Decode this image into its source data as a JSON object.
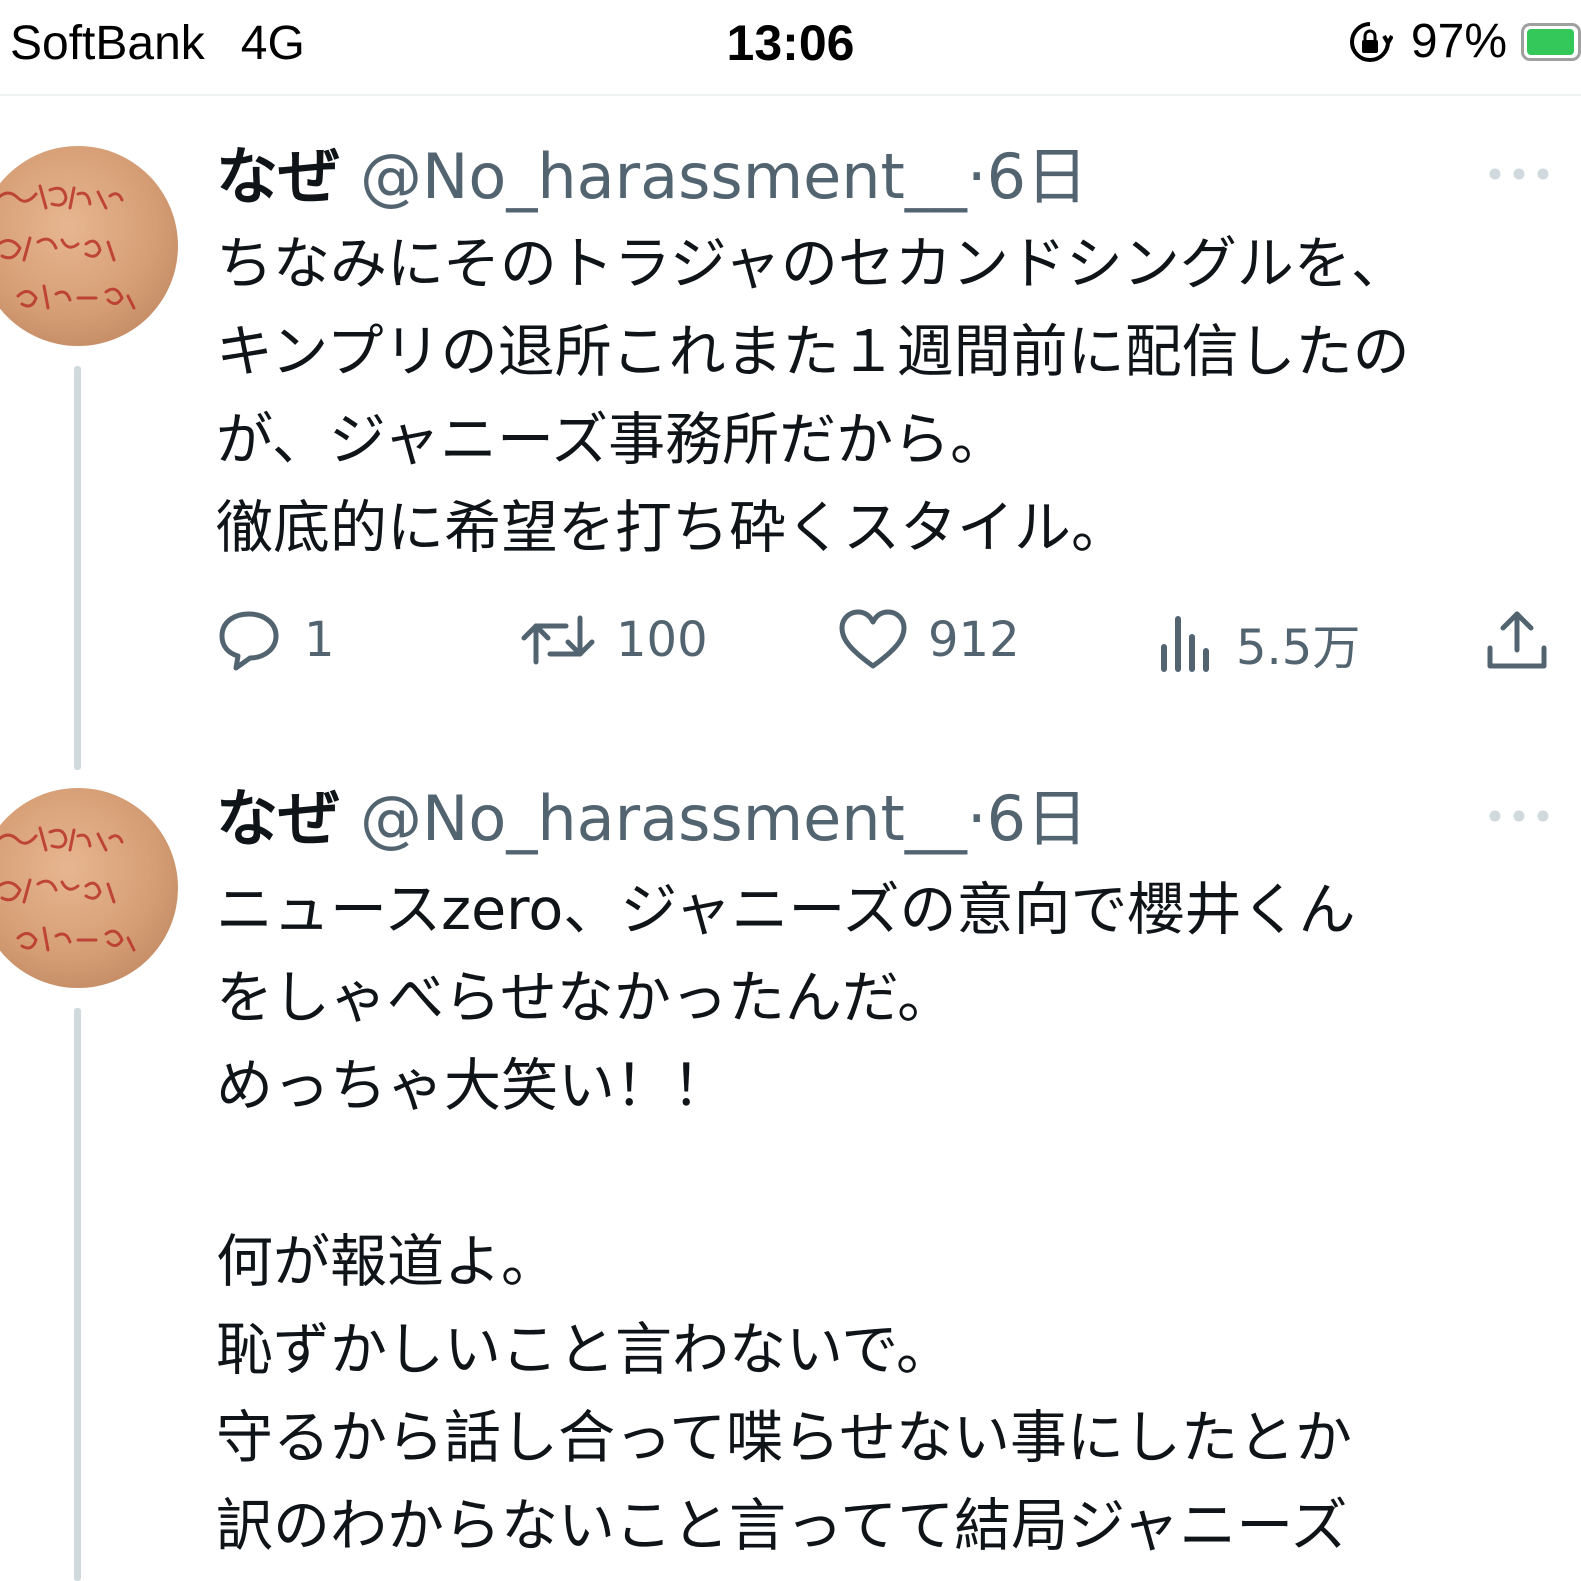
{
  "status_bar": {
    "carrier": "SoftBank",
    "network": "4G",
    "time": "13:06",
    "battery_percent": "97%",
    "battery_level": 0.97,
    "icons": [
      "orientation-lock-icon",
      "battery-icon"
    ]
  },
  "tweets": [
    {
      "name": "なぜ",
      "handle": "@No_harassment__",
      "separator": "·",
      "time": "6日",
      "lines": [
        "ちなみにそのトラジャのセカンドシングルを、",
        "キンプリの退所これまた１週間前に配信したの",
        "が、ジャニーズ事務所だから。",
        "徹底的に希望を打ち砕くスタイル。"
      ],
      "stats": {
        "replies": "1",
        "retweets": "100",
        "likes": "912",
        "views": "5.5万"
      }
    },
    {
      "name": "なぜ",
      "handle": "@No_harassment__",
      "separator": "·",
      "time": "6日",
      "lines": [
        "ニュースzero、ジャニーズの意向で櫻井くん",
        "をしゃべらせなかったんだ。",
        "めっちゃ大笑い！！",
        "",
        "何が報道よ。",
        "恥ずかしいこと言わないで。",
        "守るから話し合って喋らせない事にしたとか",
        "訳のわからないこと言ってて結局ジャニーズ"
      ]
    }
  ],
  "colors": {
    "text": "#0f1419",
    "muted": "#536471",
    "thread_line": "#cfd9de",
    "battery": "#34c759"
  }
}
